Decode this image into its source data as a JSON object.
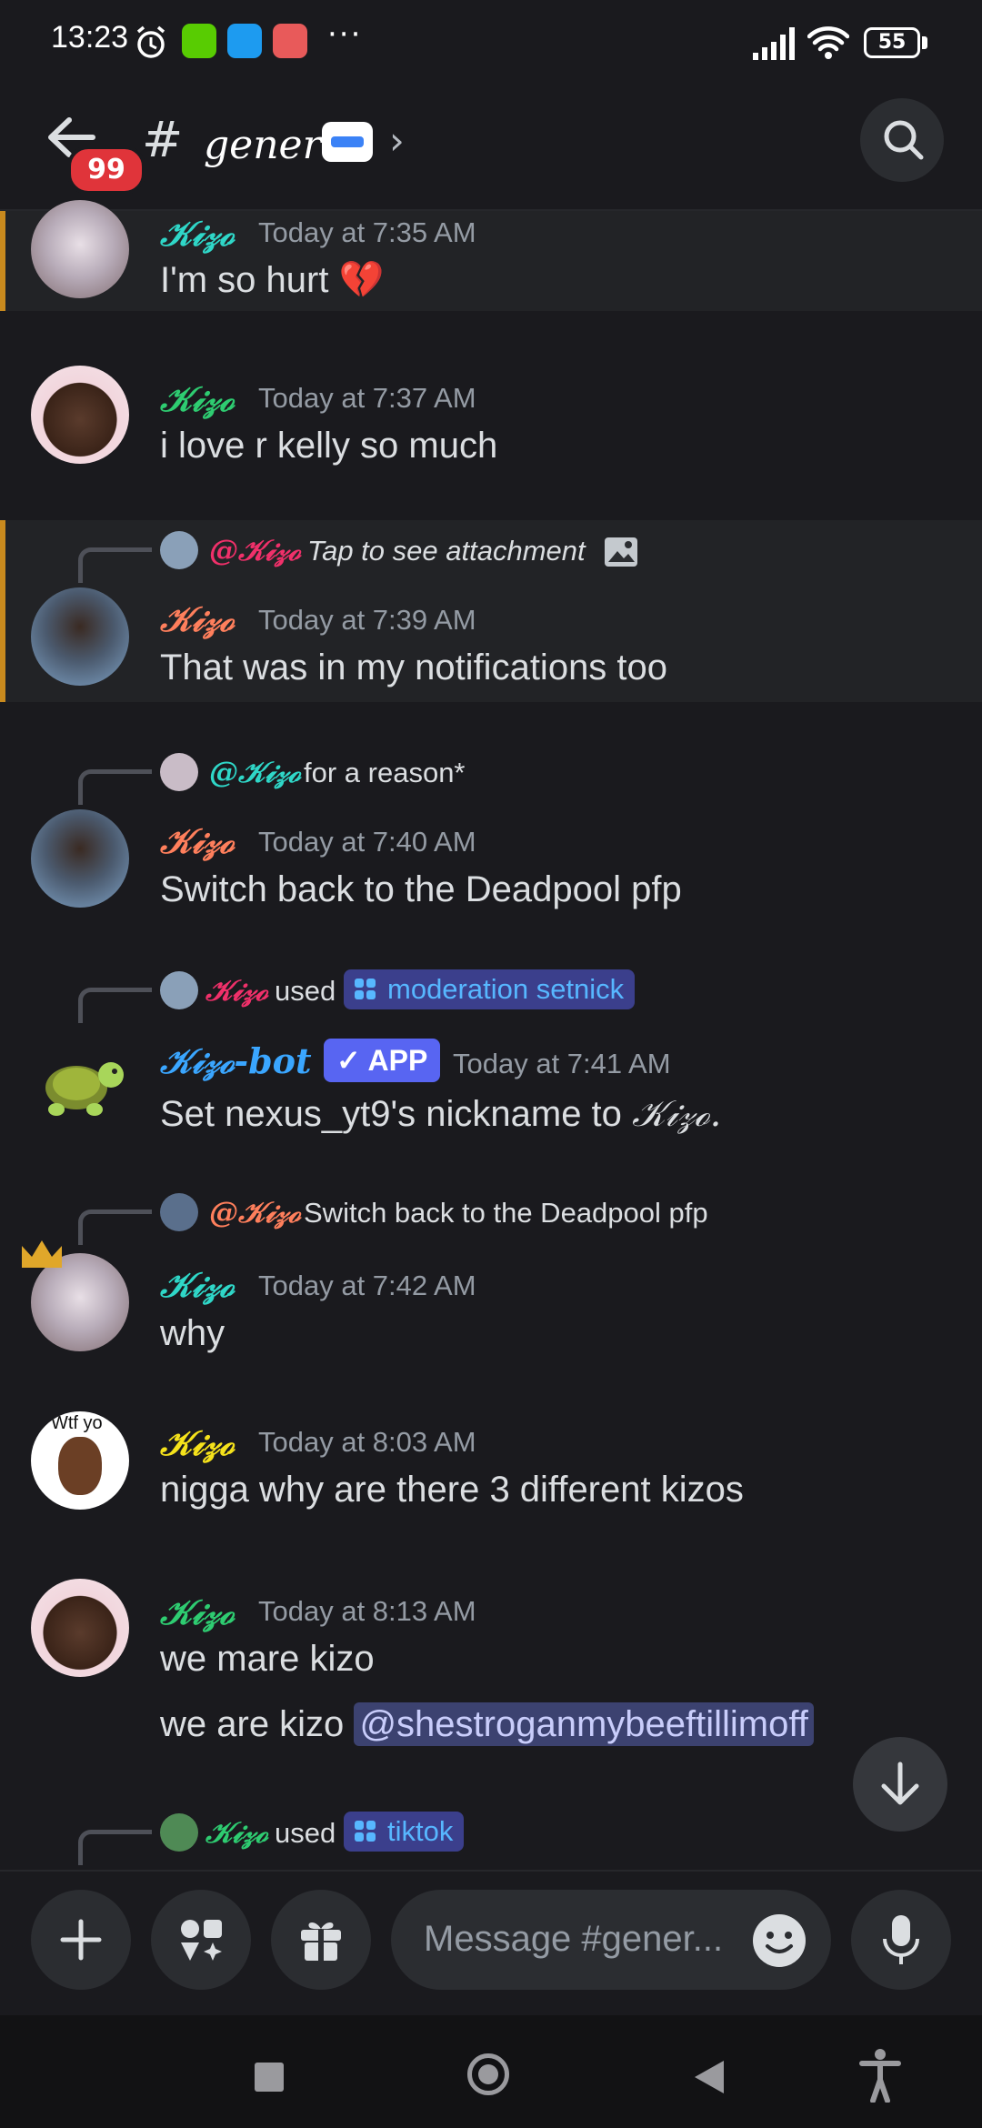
{
  "status_bar": {
    "time": "13:23",
    "more": "···",
    "battery": "55"
  },
  "header": {
    "unread_badge": "99",
    "hash": "#",
    "channel_name": "general",
    "chevron": "›"
  },
  "messages": [
    {
      "username": "𝒦𝒾𝓏ℴ",
      "name_color": "#2fd7c8",
      "timestamp": "Today at 7:35 AM",
      "text": "I'm so hurt 💔"
    },
    {
      "username": "𝒦𝒾𝓏ℴ",
      "name_color": "#2ecc71",
      "timestamp": "Today at 7:37 AM",
      "text": "i love r kelly so much"
    },
    {
      "reply_name": "@𝒦𝒾𝓏ℴ",
      "reply_color": "#f0306a",
      "reply_text": "Tap to see attachment",
      "username": "𝒦𝒾𝓏ℴ",
      "name_color": "#ff7f5c",
      "timestamp": "Today at 7:39 AM",
      "text": "That was in my notifications too"
    },
    {
      "reply_name": "@𝒦𝒾𝓏ℴ",
      "reply_color": "#2fd7c8",
      "reply_text": "for a reason*",
      "username": "𝒦𝒾𝓏ℴ",
      "name_color": "#ff7f5c",
      "timestamp": "Today at 7:40 AM",
      "text": "Switch back to the Deadpool pfp"
    },
    {
      "reply_name": "𝒦𝒾𝓏ℴ",
      "reply_color": "#f0306a",
      "reply_used": "used",
      "command": "moderation setnick",
      "username": "𝒦𝒾𝓏ℴ-bot",
      "name_color": "#3aa6ff",
      "app_badge": "✓ APP",
      "timestamp": "Today at 7:41 AM",
      "text_prefix": "Set nexus_yt9's nickname to",
      "text_suffix": "𝒦𝒾𝓏ℴ."
    },
    {
      "reply_name": "@𝒦𝒾𝓏ℴ",
      "reply_color": "#ff7f5c",
      "reply_text": "Switch back to the Deadpool pfp",
      "username": "𝒦𝒾𝓏ℴ",
      "name_color": "#2fd7c8",
      "timestamp": "Today at 7:42 AM",
      "text": "why"
    },
    {
      "username": "𝒦𝒾𝓏ℴ",
      "name_color": "#f5e21b",
      "avatar_caption": "Wtf yo",
      "timestamp": "Today at 8:03 AM",
      "text": "nigga why are there 3 different kizos"
    },
    {
      "username": "𝒦𝒾𝓏ℴ",
      "name_color": "#2ecc71",
      "timestamp": "Today at 8:13 AM",
      "text": "we mare kizo",
      "text2_prefix": "we are kizo",
      "mention": "@shestroganmybeeftillimoff"
    },
    {
      "reply_name": "𝒦𝒾𝓏ℴ",
      "reply_color": "#2ecc71",
      "reply_used": "used",
      "command": "tiktok"
    }
  ],
  "composer": {
    "placeholder": "Message #gener..."
  },
  "colors": {
    "background": "#1a1a1e",
    "accent": "#5865f2",
    "badge_red": "#e0343a"
  }
}
